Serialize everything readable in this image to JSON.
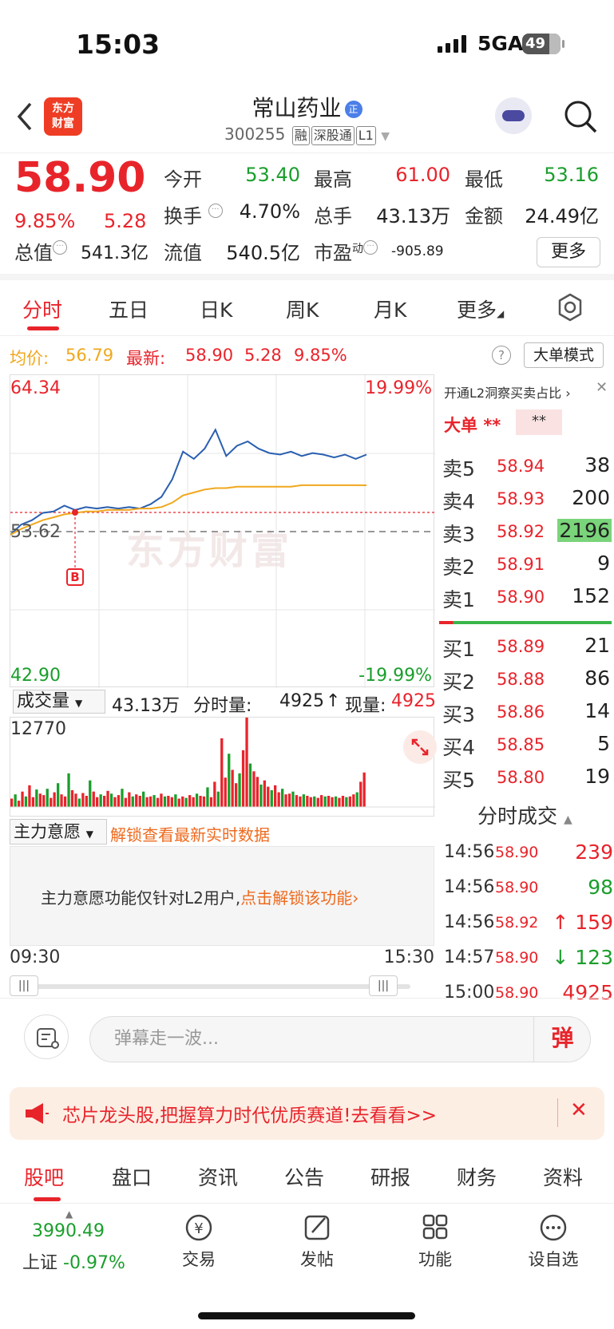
{
  "status_bar": {
    "time": "15:03",
    "network": "5GA",
    "battery": "49"
  },
  "header": {
    "logo_text_1": "东方",
    "logo_text_2": "财富",
    "stock_name": "常山药业",
    "name_badge": "正",
    "stock_code": "300255",
    "tags": [
      "融",
      "深股通",
      "L1"
    ]
  },
  "quote": {
    "price": "58.90",
    "change_pct": "9.85%",
    "change": "5.28",
    "open_label": "今开",
    "open": "53.40",
    "high_label": "最高",
    "high": "61.00",
    "low_label": "最低",
    "low": "53.16",
    "turnover_label": "换手",
    "turnover": "4.70%",
    "volume_label": "总手",
    "volume": "43.13万",
    "amount_label": "金额",
    "amount": "24.49亿",
    "total_mv_label": "总值",
    "total_mv": "541.3亿",
    "float_mv_label": "流值",
    "float_mv": "540.5亿",
    "pe_label": "市盈",
    "pe_sup": "动",
    "pe": "-905.89",
    "more_label": "更多"
  },
  "tabs": [
    "分时",
    "五日",
    "日K",
    "周K",
    "月K",
    "更多"
  ],
  "info_bar": {
    "avg_label": "均价:",
    "avg": "56.79",
    "latest_label": "最新:",
    "latest": "58.90",
    "latest_chg": "5.28",
    "latest_pct": "9.85%",
    "mode_button": "大单模式"
  },
  "chart_labels": {
    "top_price": "64.34",
    "top_pct": "19.99%",
    "mid_price": "53.62",
    "bottom_price": "42.90",
    "bottom_pct": "-19.99%",
    "b_marker": "B",
    "watermark": "东方财富"
  },
  "chart_data": {
    "type": "line",
    "ylim": [
      42.9,
      64.34
    ],
    "prev_close": 53.62,
    "x": [
      "09:30",
      "15:30"
    ],
    "series": [
      {
        "name": "价格",
        "values": [
          53.4,
          54.1,
          54.4,
          54.9,
          55.0,
          55.4,
          55.1,
          55.3,
          55.2,
          55.3,
          55.2,
          55.3,
          55.2,
          55.5,
          56.0,
          57.2,
          59.1,
          58.6,
          59.3,
          60.6,
          58.8,
          59.5,
          59.8,
          59.3,
          59.0,
          58.9,
          59.1,
          58.8,
          59.0,
          58.9,
          58.7,
          58.9,
          58.6,
          58.9
        ]
      },
      {
        "name": "均价",
        "values": [
          53.4,
          53.8,
          54.1,
          54.4,
          54.6,
          54.8,
          54.9,
          55.0,
          55.0,
          55.1,
          55.1,
          55.1,
          55.2,
          55.2,
          55.3,
          55.6,
          56.1,
          56.3,
          56.5,
          56.6,
          56.6,
          56.7,
          56.7,
          56.7,
          56.7,
          56.7,
          56.7,
          56.8,
          56.8,
          56.8,
          56.8,
          56.8,
          56.8,
          56.79
        ]
      }
    ]
  },
  "volume": {
    "select_label": "成交量",
    "total": "43.13万",
    "minute_label": "分时量:",
    "minute": "4925",
    "current_label": "现量:",
    "current": "4925",
    "max": "12770",
    "bars": [
      1200,
      1800,
      900,
      2200,
      1500,
      3100,
      1400,
      2500,
      1900,
      1700,
      2600,
      1300,
      2100,
      3400,
      1800,
      1500,
      4800,
      2400,
      1900,
      1200,
      2000,
      1600,
      3800,
      2200,
      1400,
      1800,
      1600,
      2300,
      1900,
      1400,
      1700,
      2600,
      1300,
      2100,
      1500,
      1800,
      1600,
      2200,
      1400,
      1500,
      1700,
      1300,
      1900,
      1500,
      1600,
      1400,
      1800,
      1200,
      1500,
      1300,
      1700,
      1400,
      1900,
      1600,
      1500,
      2800,
      1400,
      3600,
      2200,
      9800,
      4200,
      7600,
      5300,
      3400,
      4800,
      8100,
      12770,
      6200,
      5100,
      4300,
      3200,
      3800,
      2900,
      2400,
      3100,
      2100,
      2600,
      1800,
      1900,
      2200,
      1700,
      1500,
      1800,
      1600,
      1400,
      1500,
      1300,
      1700,
      1500,
      1600,
      1400,
      1500,
      1300,
      1600,
      1400,
      1500,
      1800,
      2100,
      3600,
      4925
    ]
  },
  "main_force": {
    "select_label": "主力意愿",
    "unlock_hint": "解锁查看最新实时数据",
    "l2_msg": "主力意愿功能仅针对L2用户,",
    "l2_link": "点击解锁该功能"
  },
  "time_axis": {
    "start": "09:30",
    "end": "15:30"
  },
  "right_panel": {
    "l2_header": "开通L2洞察买卖占比",
    "big_order_label": "大单",
    "big_order_val1": "**",
    "big_order_val2": "**",
    "asks": [
      {
        "label": "卖5",
        "price": "58.94",
        "vol": "38"
      },
      {
        "label": "卖4",
        "price": "58.93",
        "vol": "200"
      },
      {
        "label": "卖3",
        "price": "58.92",
        "vol": "2196"
      },
      {
        "label": "卖2",
        "price": "58.91",
        "vol": "9"
      },
      {
        "label": "卖1",
        "price": "58.90",
        "vol": "152"
      }
    ],
    "bids": [
      {
        "label": "买1",
        "price": "58.89",
        "vol": "21"
      },
      {
        "label": "买2",
        "price": "58.88",
        "vol": "86"
      },
      {
        "label": "买3",
        "price": "58.86",
        "vol": "14"
      },
      {
        "label": "买4",
        "price": "58.85",
        "vol": "5"
      },
      {
        "label": "买5",
        "price": "58.80",
        "vol": "19"
      }
    ],
    "trades_title": "分时成交",
    "trades": [
      {
        "time": "14:56",
        "price": "58.90",
        "vol": "239",
        "dir": ""
      },
      {
        "time": "14:56",
        "price": "58.90",
        "vol": "98",
        "dir": ""
      },
      {
        "time": "14:56",
        "price": "58.92",
        "vol": "↑ 159",
        "dir": "up"
      },
      {
        "time": "14:57",
        "price": "58.90",
        "vol": "↓ 123",
        "dir": "down"
      },
      {
        "time": "15:00",
        "price": "58.90",
        "vol": "4925",
        "dir": ""
      }
    ]
  },
  "comment_bar": {
    "placeholder": "弹幕走一波...",
    "danmu_label": "弹"
  },
  "promo": {
    "text": "芯片龙头股,把握算力时代优质赛道!去看看>>"
  },
  "bottom_tabs": [
    "股吧",
    "盘口",
    "资讯",
    "公告",
    "研报",
    "财务",
    "资料"
  ],
  "footer": {
    "index_value": "3990.49",
    "index_label": "上证",
    "index_pct": "-0.97%",
    "items": [
      "交易",
      "发帖",
      "功能",
      "设自选"
    ]
  },
  "colors": {
    "up": "#e8242b",
    "down": "#1a9e2c",
    "avg_line": "#f0a81e",
    "price_line": "#2a5fb0"
  }
}
